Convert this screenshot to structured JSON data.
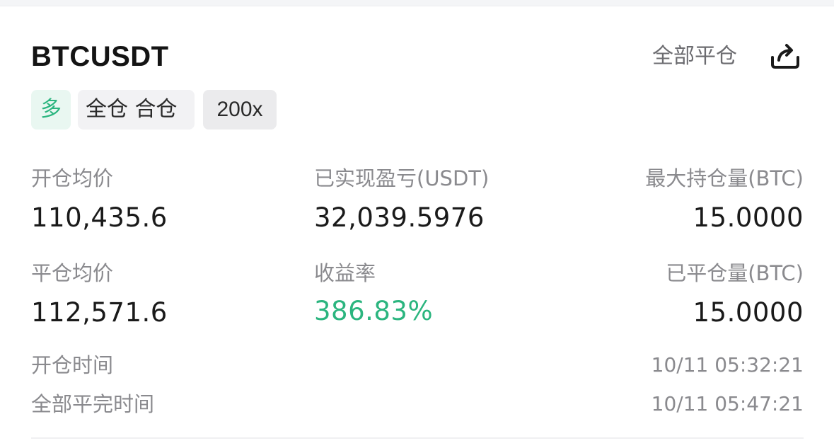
{
  "header": {
    "symbol": "BTCUSDT",
    "close_all_label": "全部平仓",
    "share_icon": "share-icon"
  },
  "tags": {
    "side": "多",
    "margin_mode": "全仓 合仓",
    "leverage": "200x"
  },
  "stats": {
    "open_avg_price_label": "开仓均价",
    "open_avg_price": "110,435.6",
    "realized_pnl_label": "已实现盈亏(USDT)",
    "realized_pnl": "32,039.5976",
    "max_position_label": "最大持仓量(BTC)",
    "max_position": "15.0000",
    "close_avg_price_label": "平仓均价",
    "close_avg_price": "112,571.6",
    "roi_label": "收益率",
    "roi": "386.83%",
    "closed_qty_label": "已平仓量(BTC)",
    "closed_qty": "15.0000"
  },
  "times": {
    "open_time_label": "开仓时间",
    "open_time": "10/11 05:32:21",
    "full_close_time_label": "全部平完时间",
    "full_close_time": "10/11 05:47:21"
  },
  "colors": {
    "profit_green": "#2bb57f",
    "long_tag_bg": "#e9f7f1",
    "tag_bg": "#f2f2f4"
  }
}
